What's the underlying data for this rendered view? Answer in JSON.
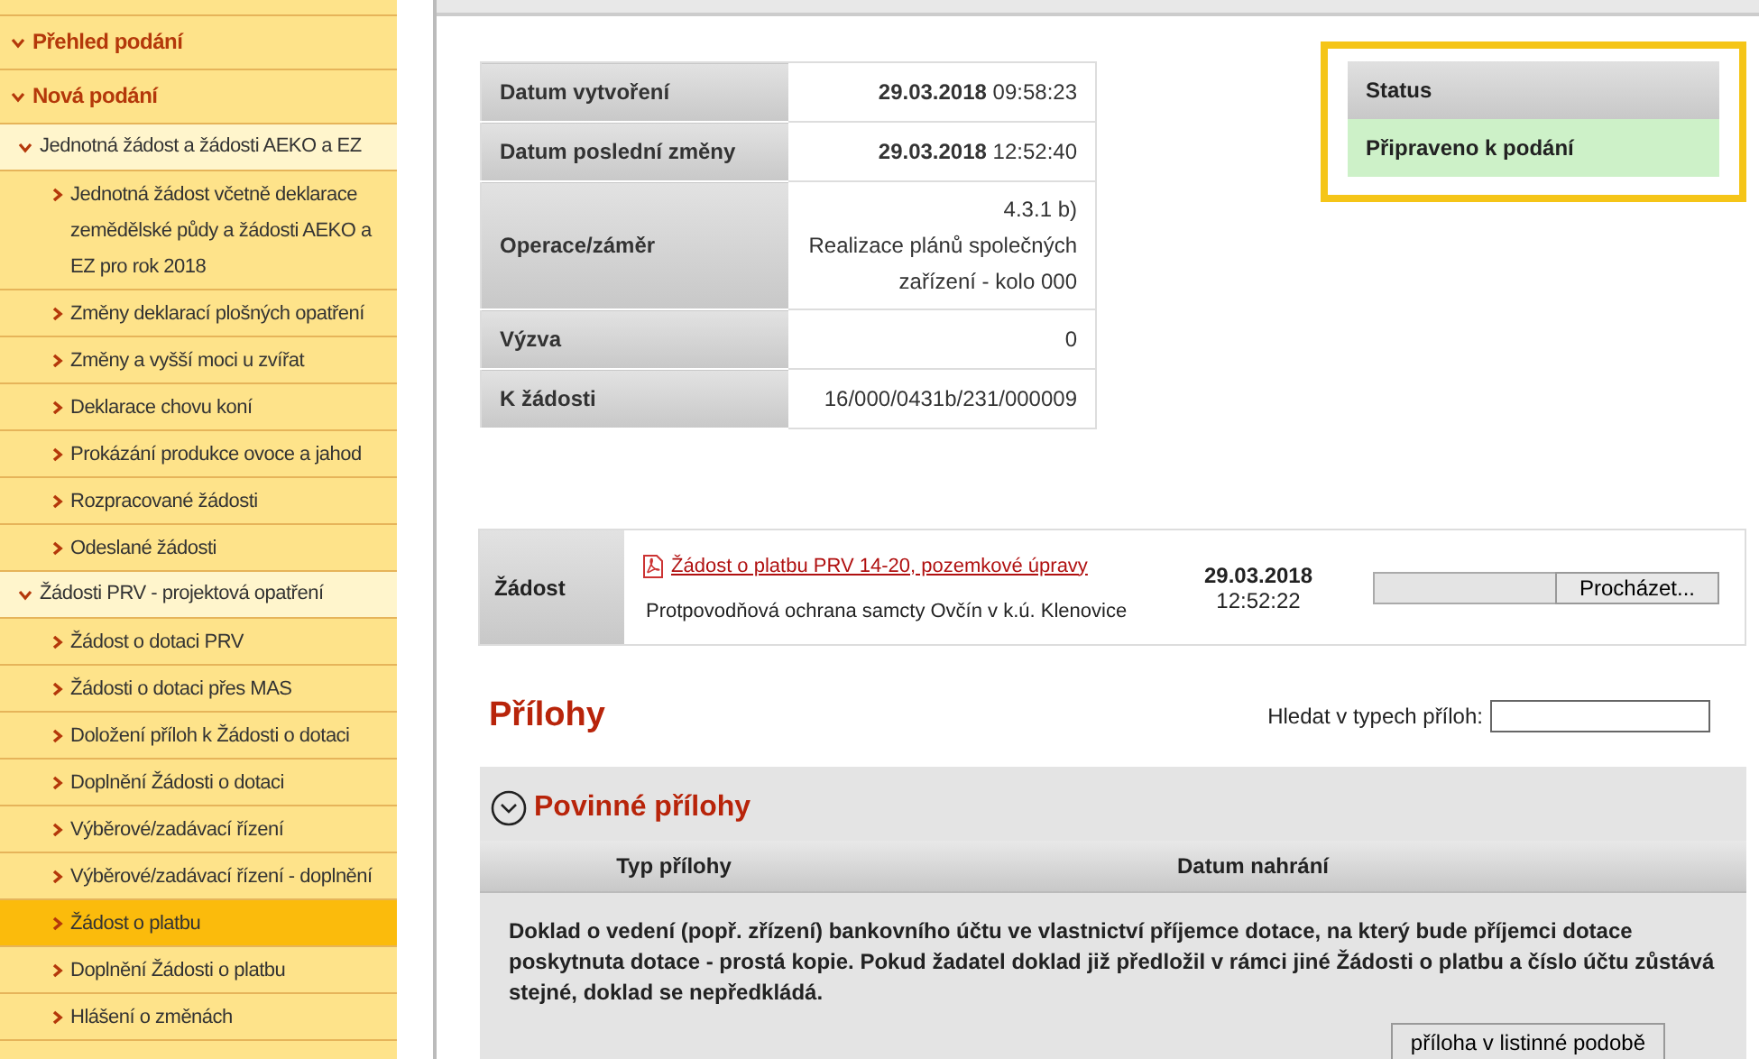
{
  "sidebar": {
    "items": [
      {
        "label": "Přehled podání",
        "selected": false
      },
      {
        "label": "Nová podání",
        "selected": false,
        "children": [
          {
            "label": "Jednotná žádost a žádosti AEKO a EZ",
            "selected": false,
            "children": [
              {
                "label": "Jednotná žádost včetně deklarace zemědělské půdy a žádosti AEKO a EZ pro rok 2018",
                "selected": false
              },
              {
                "label": "Změny deklarací plošných opatření",
                "selected": false
              },
              {
                "label": "Změny a vyšší moci u zvířat",
                "selected": false
              },
              {
                "label": "Deklarace chovu koní",
                "selected": false
              },
              {
                "label": "Prokázání produkce ovoce a jahod",
                "selected": false
              },
              {
                "label": "Rozpracované žádosti",
                "selected": false
              },
              {
                "label": "Odeslané žádosti",
                "selected": false
              }
            ]
          },
          {
            "label": "Žádosti PRV - projektová opatření",
            "selected": false,
            "children": [
              {
                "label": "Žádost o dotaci PRV",
                "selected": false
              },
              {
                "label": "Žádosti o dotaci přes MAS",
                "selected": false
              },
              {
                "label": "Doložení příloh k Žádosti o dotaci",
                "selected": false
              },
              {
                "label": "Doplnění Žádosti o dotaci",
                "selected": false
              },
              {
                "label": "Výběrové/zadávací řízení",
                "selected": false
              },
              {
                "label": "Výběrové/zadávací řízení - doplnění",
                "selected": false
              },
              {
                "label": "Žádost o platbu",
                "selected": true
              },
              {
                "label": "Doplnění Žádosti o platbu",
                "selected": false
              },
              {
                "label": "Hlášení o změnách",
                "selected": false
              }
            ]
          }
        ]
      }
    ]
  },
  "details": [
    {
      "kind": "datetime",
      "label": "Datum vytvoření",
      "date": "29.03.2018",
      "time": "09:58:23"
    },
    {
      "kind": "datetime",
      "label": "Datum poslední změny",
      "date": "29.03.2018",
      "time": "12:52:40"
    },
    {
      "kind": "text",
      "label": "Operace/záměr",
      "lines": [
        "4.3.1 b)",
        "Realizace plánů společných",
        "zařízení - kolo 000"
      ]
    },
    {
      "kind": "text",
      "label": "Výzva",
      "lines": [
        "0"
      ]
    },
    {
      "kind": "text",
      "label": "K žádosti",
      "lines": [
        "16/000/0431b/231/000009"
      ]
    }
  ],
  "status": {
    "header": "Status",
    "value": "Připraveno k podání"
  },
  "application": {
    "label": "Žádost",
    "link": "Žádost o platbu PRV 14-20, pozemkové úpravy",
    "description": "Protpovodňová ochrana samcty Ovčín v k.ú. Klenovice",
    "date": "29.03.2018",
    "time": "12:52:22",
    "browse_button": "Procházet..."
  },
  "attachments": {
    "title": "Přílohy",
    "search_label": "Hledat v typech příloh:",
    "section": {
      "title": "Povinné přílohy",
      "columns": [
        "Typ přílohy",
        "Datum nahrání"
      ],
      "rows": [
        {
          "description": "Doklad o vedení (popř. zřízení) bankovního účtu ve vlastnictví příjemce dotace, na který bude příjemci dotace poskytnuta dotace - prostá kopie. Pokud žadatel doklad již předložil v rámci jiné Žádosti o platbu a číslo účtu zůstává stejné, doklad se nepředkládá.",
          "button": "příloha v listinné podobě"
        }
      ]
    }
  }
}
